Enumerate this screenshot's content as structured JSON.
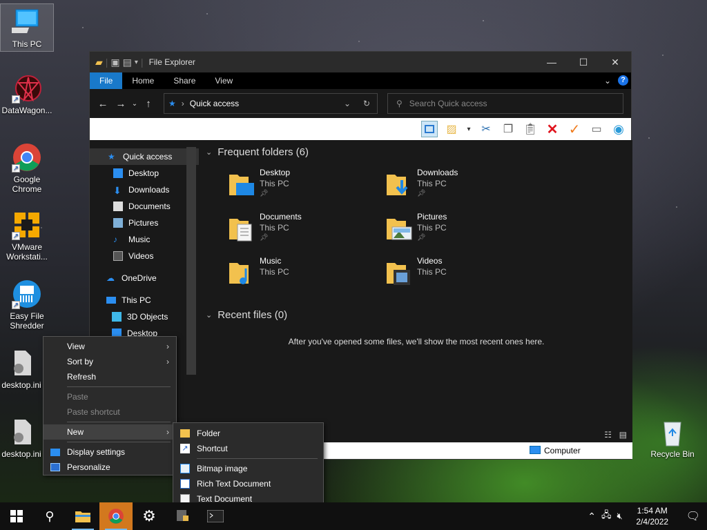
{
  "desktop": {
    "icons": [
      {
        "label": "This PC",
        "name": "this-pc"
      },
      {
        "label": "DataWagon...",
        "name": "datawagon"
      },
      {
        "label": "Google Chrome",
        "name": "google-chrome"
      },
      {
        "label": "VMware Workstati...",
        "name": "vmware"
      },
      {
        "label": "Easy File Shredder",
        "name": "easy-file-shredder"
      },
      {
        "label": "desktop.ini",
        "name": "desktop-ini-1"
      },
      {
        "label": "desktop.ini",
        "name": "desktop-ini-2"
      },
      {
        "label": "Recycle Bin",
        "name": "recycle-bin"
      }
    ]
  },
  "explorer": {
    "title": "File Explorer",
    "tabs": [
      "File",
      "Home",
      "Share",
      "View"
    ],
    "address": "Quick access",
    "search_placeholder": "Search Quick access",
    "nav": {
      "quick_access": "Quick access",
      "items": [
        "Desktop",
        "Downloads",
        "Documents",
        "Pictures",
        "Music",
        "Videos"
      ],
      "onedrive": "OneDrive",
      "this_pc": "This PC",
      "this_pc_items": [
        "3D Objects",
        "Desktop"
      ]
    },
    "frequent_header": "Frequent folders (6)",
    "folders": [
      {
        "name": "Desktop",
        "loc": "This PC",
        "pinned": true
      },
      {
        "name": "Downloads",
        "loc": "This PC",
        "pinned": true
      },
      {
        "name": "Documents",
        "loc": "This PC",
        "pinned": true
      },
      {
        "name": "Pictures",
        "loc": "This PC",
        "pinned": true
      },
      {
        "name": "Music",
        "loc": "This PC",
        "pinned": false
      },
      {
        "name": "Videos",
        "loc": "This PC",
        "pinned": false
      }
    ],
    "recent_header": "Recent files (0)",
    "recent_empty": "After you've opened some files, we'll show the most recent ones here.",
    "status_computer": "Computer"
  },
  "context_menu": {
    "items": {
      "view": "View",
      "sort_by": "Sort by",
      "refresh": "Refresh",
      "paste": "Paste",
      "paste_shortcut": "Paste shortcut",
      "new": "New",
      "display_settings": "Display settings",
      "personalize": "Personalize"
    }
  },
  "new_submenu": {
    "folder": "Folder",
    "shortcut": "Shortcut",
    "bitmap": "Bitmap image",
    "rtf": "Rich Text Document",
    "text": "Text Document"
  },
  "taskbar": {
    "time": "1:54 AM",
    "date": "2/4/2022",
    "accent": "#76b9ed"
  }
}
